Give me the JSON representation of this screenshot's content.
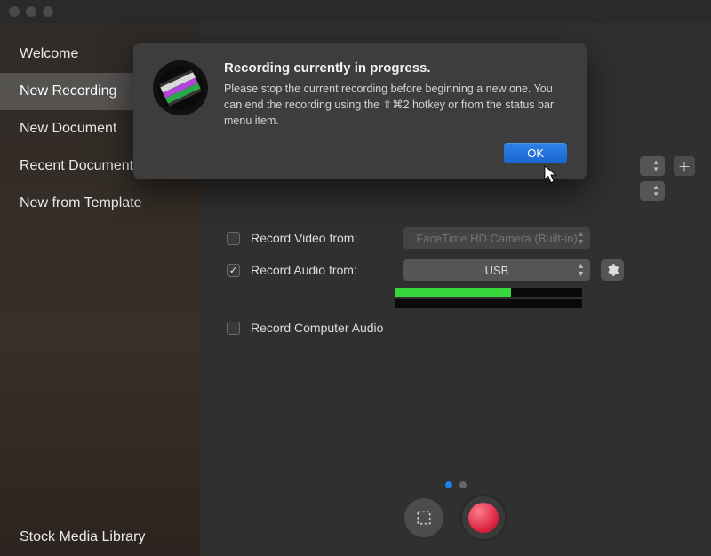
{
  "sidebar": {
    "items": [
      {
        "label": "Welcome"
      },
      {
        "label": "New Recording"
      },
      {
        "label": "New Document"
      },
      {
        "label": "Recent Documents"
      },
      {
        "label": "New from Template"
      }
    ],
    "footer_label": "Stock Media Library",
    "selected_index": 1
  },
  "content": {
    "record_video_label": "Record Video from:",
    "record_video_checked": false,
    "video_source": "FaceTime HD Camera (Built-in)",
    "record_audio_label": "Record Audio from:",
    "record_audio_checked": true,
    "audio_source": "USB",
    "record_computer_audio_label": "Record Computer Audio",
    "record_computer_audio_checked": false,
    "audio_level_pct": 62,
    "page_dots": {
      "count": 2,
      "active": 0
    }
  },
  "dialog": {
    "title": "Recording currently in progress.",
    "body": "Please stop the current recording before beginning a new one.  You can end the recording using the ⇧⌘2 hotkey or from the status bar menu item.",
    "ok_label": "OK"
  },
  "icons": {
    "gear": "gear-icon",
    "plus": "plus-icon",
    "crop": "crop-selection-icon",
    "record": "record-icon",
    "app": "screenflow-app-icon",
    "cursor": "mouse-cursor-icon"
  }
}
